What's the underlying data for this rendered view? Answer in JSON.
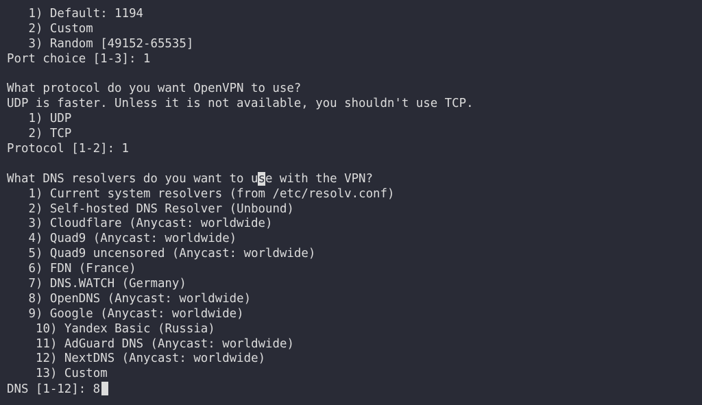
{
  "port": {
    "options": [
      "1) Default: 1194",
      "2) Custom",
      "3) Random [49152-65535]"
    ],
    "prompt": "Port choice [1-3]: 1"
  },
  "protocol": {
    "question": "What protocol do you want OpenVPN to use?",
    "note": "UDP is faster. Unless it is not available, you shouldn't use TCP.",
    "options": [
      "1) UDP",
      "2) TCP"
    ],
    "prompt": "Protocol [1-2]: 1"
  },
  "dns": {
    "question_pre": "What DNS resolvers do you want to u",
    "question_highlight": "s",
    "question_post": "e with the VPN?",
    "options": [
      "1) Current system resolvers (from /etc/resolv.conf)",
      "2) Self-hosted DNS Resolver (Unbound)",
      "3) Cloudflare (Anycast: worldwide)",
      "4) Quad9 (Anycast: worldwide)",
      "5) Quad9 uncensored (Anycast: worldwide)",
      "6) FDN (France)",
      "7) DNS.WATCH (Germany)",
      "8) OpenDNS (Anycast: worldwide)",
      "9) Google (Anycast: worldwide)"
    ],
    "options_two_digit": [
      "10) Yandex Basic (Russia)",
      "11) AdGuard DNS (Anycast: worldwide)",
      "12) NextDNS (Anycast: worldwide)",
      "13) Custom"
    ],
    "prompt": "DNS [1-12]: 8"
  },
  "colors": {
    "background": "#292b36",
    "foreground": "#dcdcdc"
  }
}
